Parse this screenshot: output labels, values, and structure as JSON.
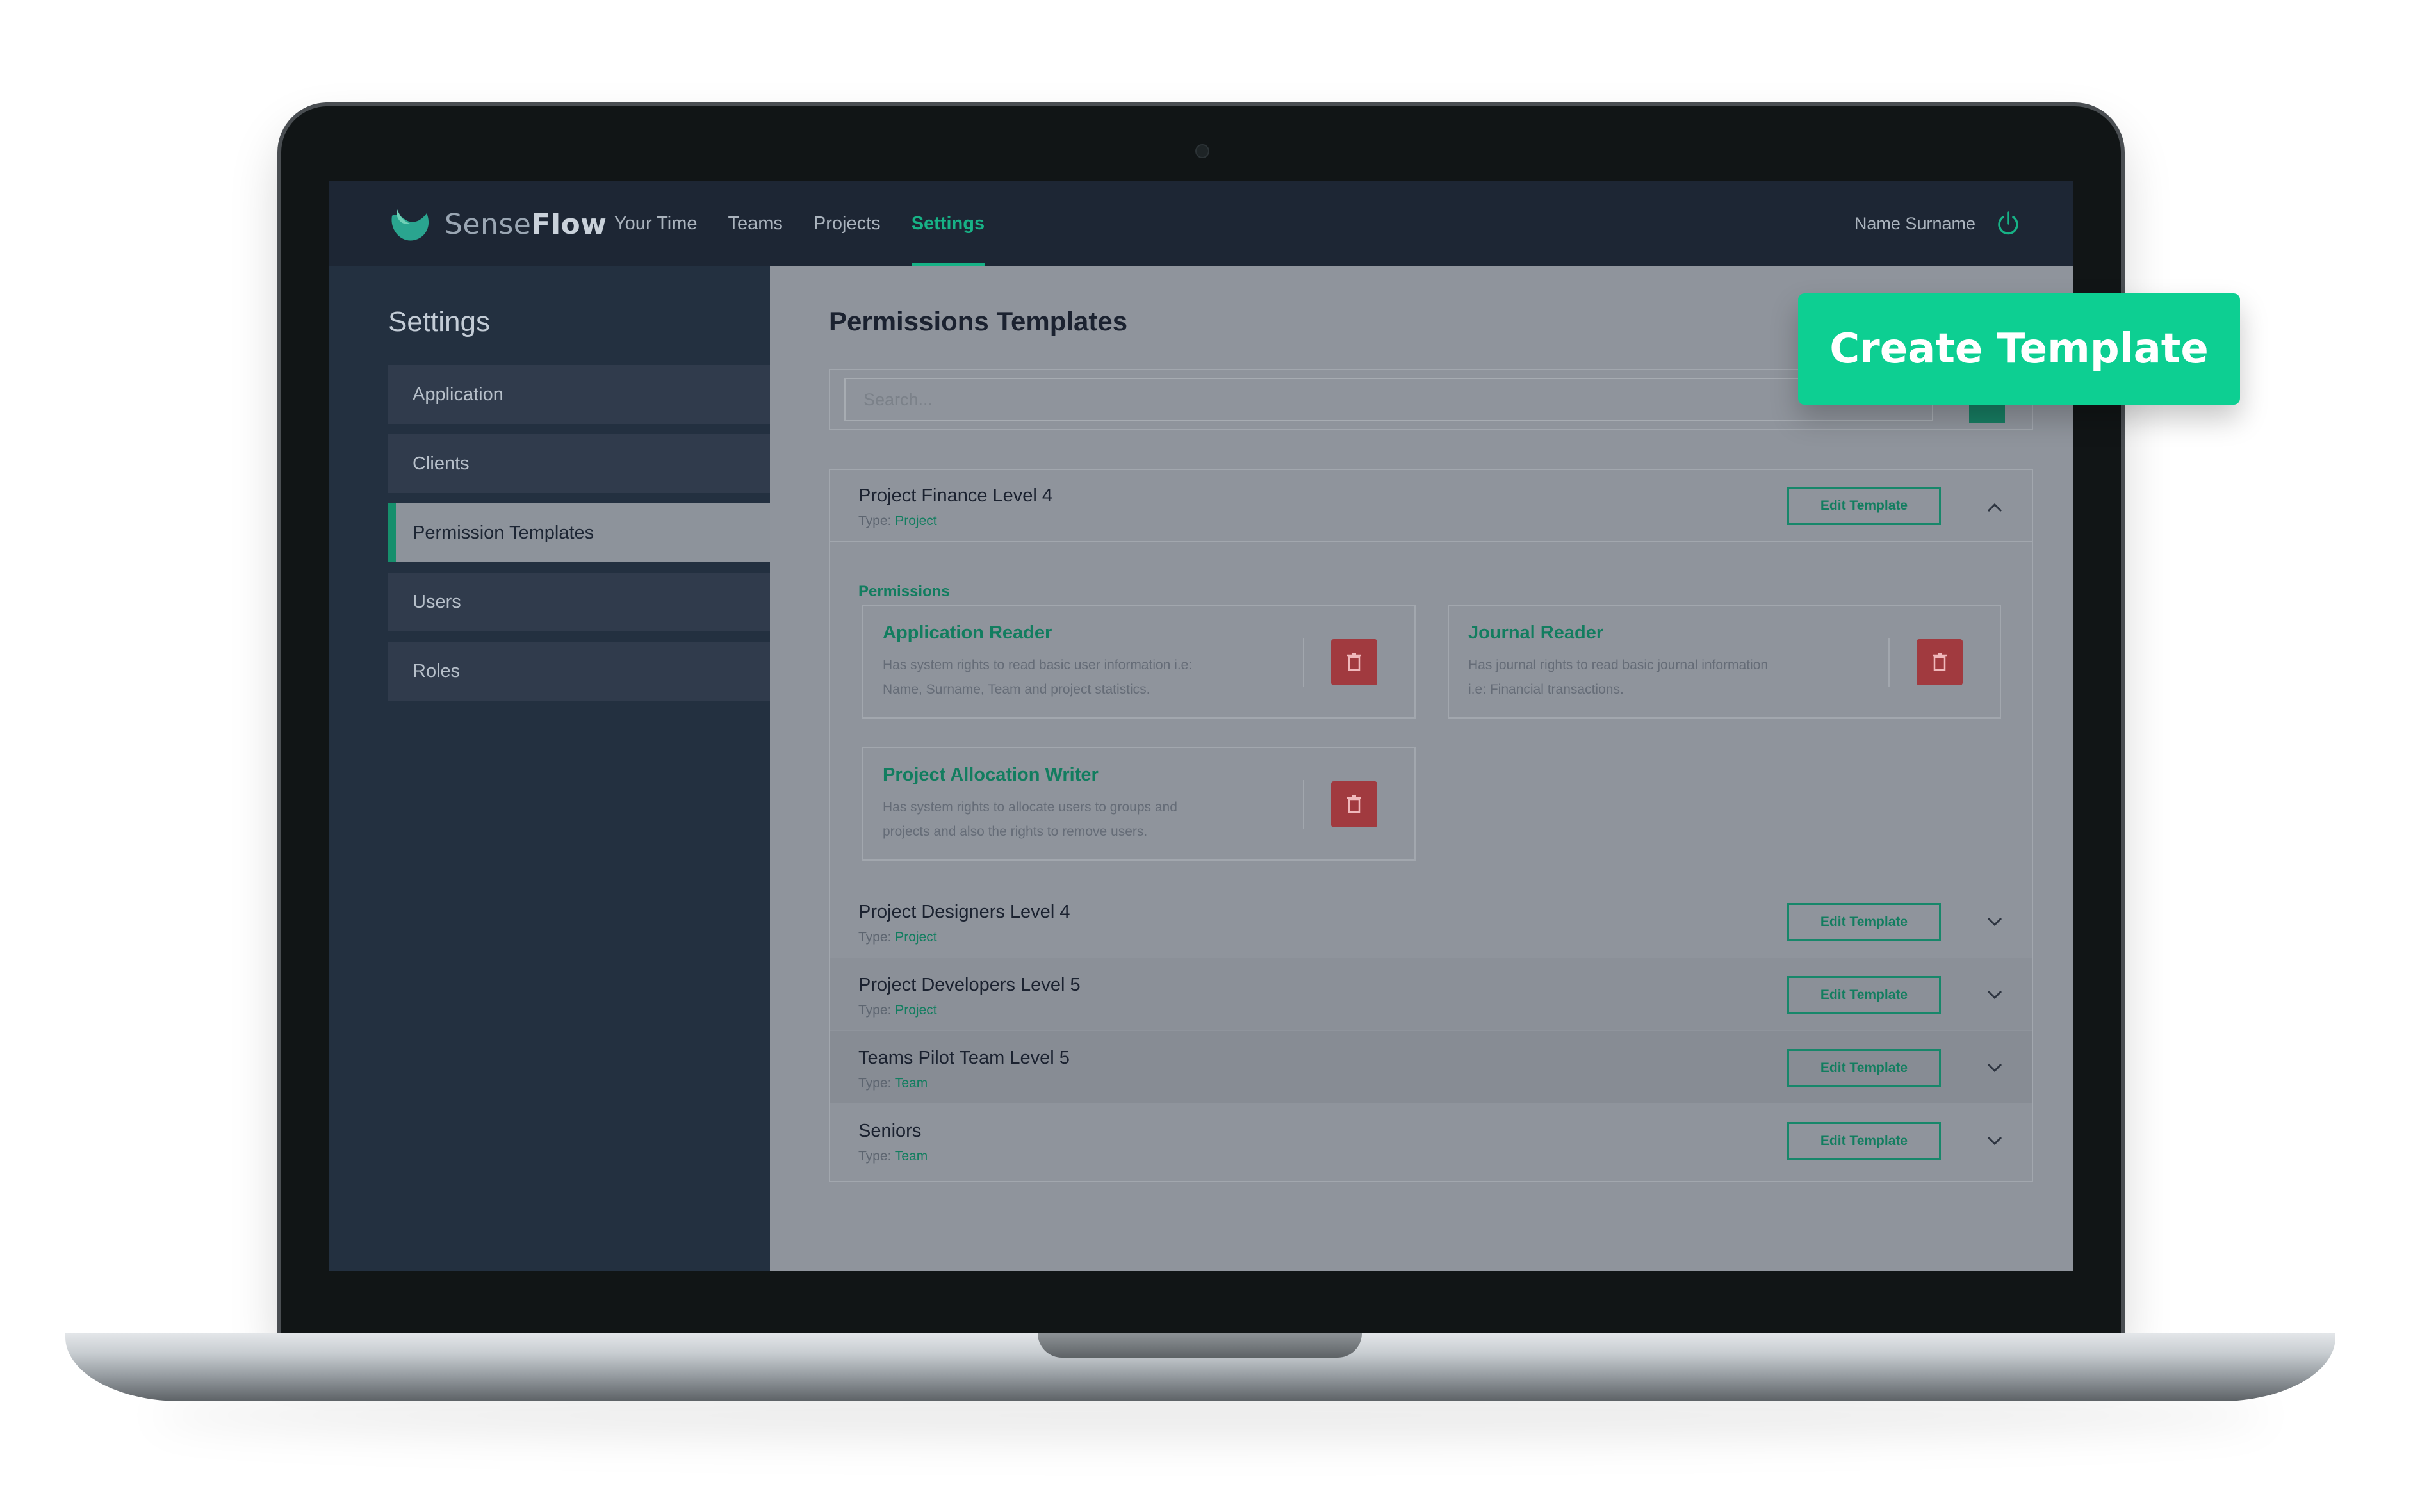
{
  "app": {
    "logo_light": "Sense",
    "logo_bold": "Flow",
    "nav": [
      "Your Time",
      "Teams",
      "Projects",
      "Settings"
    ],
    "active_nav": "Settings",
    "user_name": "Name Surname"
  },
  "sidebar": {
    "title": "Settings",
    "items": [
      "Application",
      "Clients",
      "Permission Templates",
      "Users",
      "Roles"
    ],
    "active": "Permission Templates"
  },
  "main": {
    "title": "Permissions Templates",
    "search_placeholder": "Search...",
    "type_prefix": "Type:",
    "edit_label": "Edit Template",
    "permissions_label": "Permissions",
    "templates": [
      {
        "name": "Project Finance Level 4",
        "type": "Project",
        "expanded": true
      },
      {
        "name": "Project Designers Level 4",
        "type": "Project",
        "expanded": false
      },
      {
        "name": "Project Developers Level 5",
        "type": "Project",
        "expanded": false
      },
      {
        "name": "Teams Pilot Team Level 5",
        "type": "Team",
        "expanded": false
      },
      {
        "name": "Seniors",
        "type": "Team",
        "expanded": false
      }
    ],
    "permissions": [
      {
        "title": "Application Reader",
        "desc_1": "Has system rights to read basic user information i.e:",
        "desc_2": "Name, Surname, Team and project statistics."
      },
      {
        "title": "Journal Reader",
        "desc_1": "Has journal rights to read basic journal information",
        "desc_2": "i.e: Financial transactions."
      },
      {
        "title": "Project Allocation Writer",
        "desc_1": "Has system rights to allocate users to groups and",
        "desc_2": "projects and also the rights to remove users."
      }
    ]
  },
  "cta_label": "Create Template",
  "colors": {
    "accent": "#17b286",
    "cta": "#0dcf92",
    "danger": "#a13a3f",
    "nav_bg": "#1d2634",
    "sidebar_bg": "#233040"
  }
}
